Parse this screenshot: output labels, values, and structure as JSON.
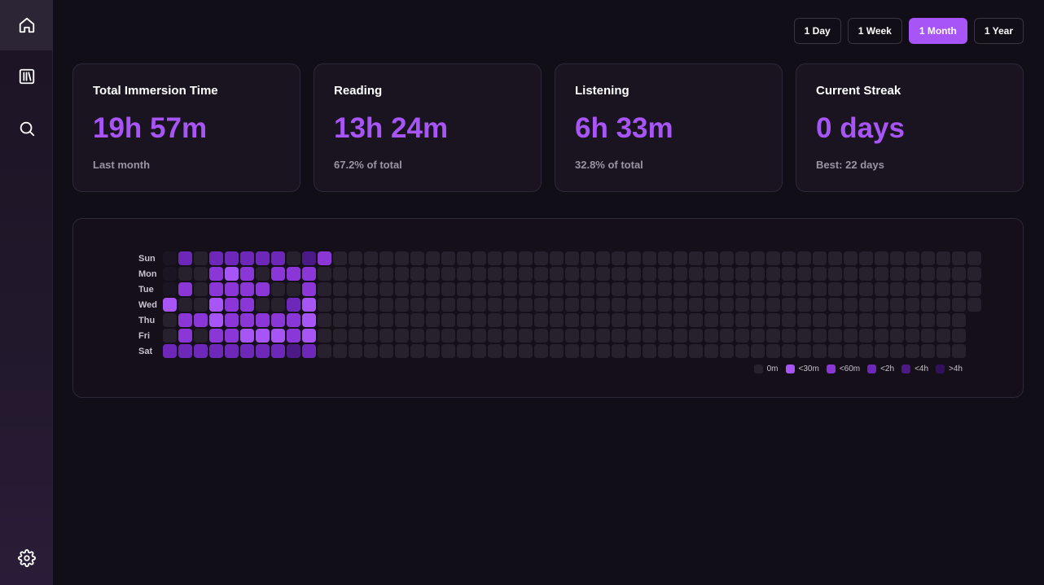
{
  "nav": {
    "home_icon": "home-icon",
    "library_icon": "library-icon",
    "search_icon": "search-icon",
    "settings_icon": "gear-icon"
  },
  "range": {
    "options": [
      "1 Day",
      "1 Week",
      "1 Month",
      "1 Year"
    ],
    "selected": "1 Month"
  },
  "stats": [
    {
      "title": "Total Immersion Time",
      "value": "19h 57m",
      "sub": "Last month"
    },
    {
      "title": "Reading",
      "value": "13h 24m",
      "sub": "67.2% of total"
    },
    {
      "title": "Listening",
      "value": "6h 33m",
      "sub": "32.8% of total"
    },
    {
      "title": "Current Streak",
      "value": "0 days",
      "sub": "Best: 22 days"
    }
  ],
  "heatmap": {
    "day_labels": [
      "Sun",
      "Mon",
      "Tue",
      "Wed",
      "Thu",
      "Fri",
      "Sat"
    ],
    "colors": {
      "empty": "#27212e",
      "zero": "#1b1422",
      "lt30m": "#a855f7",
      "lt60m": "#8b36d6",
      "lt2h": "#6d28b9",
      "lt4h": "#4b1a86",
      "gt4h": "#33105e"
    },
    "legend": [
      {
        "label": "0m",
        "level": "empty"
      },
      {
        "label": "<30m",
        "level": "lt30m"
      },
      {
        "label": "<60m",
        "level": "lt60m"
      },
      {
        "label": "<2h",
        "level": "lt2h"
      },
      {
        "label": "<4h",
        "level": "lt4h"
      },
      {
        "label": ">4h",
        "level": "gt4h"
      }
    ],
    "total_weeks": 53,
    "last_week_days": 4,
    "active_weeks": [
      [
        "zero",
        "zero",
        "zero",
        "lt30m",
        "empty",
        "empty",
        "lt2h"
      ],
      [
        "lt2h",
        "empty",
        "lt60m",
        "empty",
        "lt60m",
        "lt60m",
        "lt2h"
      ],
      [
        "empty",
        "empty",
        "empty",
        "empty",
        "lt60m",
        "empty",
        "lt2h"
      ],
      [
        "lt2h",
        "lt60m",
        "lt60m",
        "lt30m",
        "lt30m",
        "lt60m",
        "lt2h"
      ],
      [
        "lt2h",
        "lt30m",
        "lt60m",
        "lt60m",
        "lt60m",
        "lt60m",
        "lt2h"
      ],
      [
        "lt2h",
        "lt60m",
        "lt60m",
        "lt60m",
        "lt60m",
        "lt30m",
        "lt2h"
      ],
      [
        "lt2h",
        "empty",
        "lt60m",
        "empty",
        "lt60m",
        "lt30m",
        "lt2h"
      ],
      [
        "lt2h",
        "lt60m",
        "empty",
        "empty",
        "lt60m",
        "lt30m",
        "lt2h"
      ],
      [
        "empty",
        "lt60m",
        "empty",
        "lt2h",
        "lt60m",
        "lt60m",
        "lt4h"
      ],
      [
        "lt4h",
        "lt60m",
        "lt60m",
        "lt30m",
        "lt30m",
        "lt30m",
        "lt2h"
      ],
      [
        "lt60m",
        "empty",
        "empty",
        "empty",
        "empty",
        "empty",
        "empty"
      ]
    ]
  }
}
